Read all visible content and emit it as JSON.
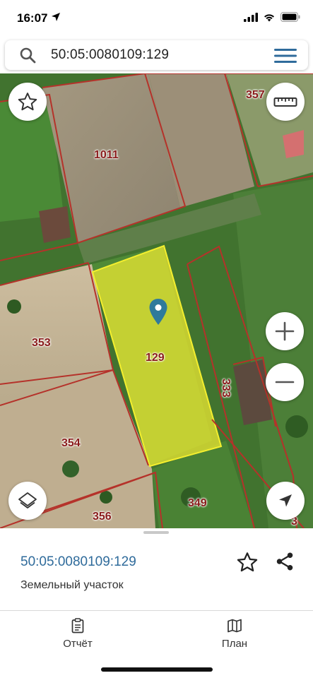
{
  "status_bar": {
    "time": "16:07"
  },
  "search": {
    "query": "50:05:0080109:129"
  },
  "map": {
    "parcels": {
      "p1011": "1011",
      "p357": "357",
      "p353": "353",
      "p129": "129",
      "p333": "333",
      "p354": "354",
      "p356": "356",
      "p349": "349",
      "p3": "3"
    },
    "selected_parcel_color": "#e6e432",
    "boundary_color": "#b5322a"
  },
  "info_panel": {
    "cadastral_number": "50:05:0080109:129",
    "object_type": "Земельный участок"
  },
  "bottom_nav": {
    "report_label": "Отчёт",
    "plan_label": "План"
  },
  "colors": {
    "accent": "#2f6b9b"
  }
}
